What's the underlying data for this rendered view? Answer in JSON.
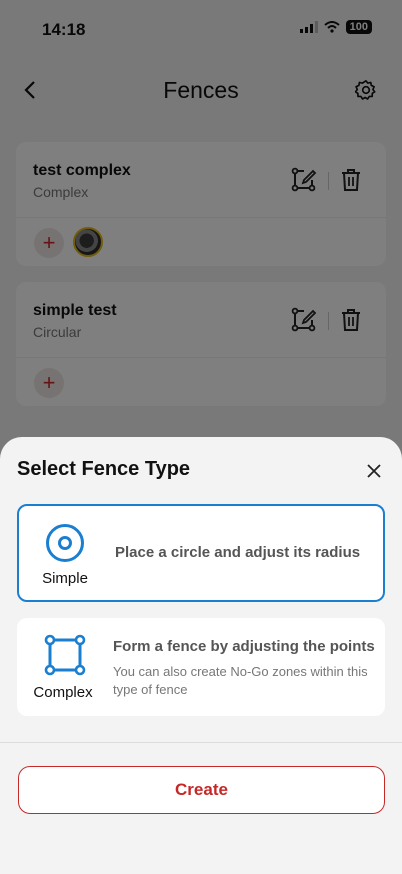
{
  "status_bar": {
    "time": "14:18",
    "battery": "100"
  },
  "nav": {
    "title": "Fences"
  },
  "fences": [
    {
      "name": "test complex",
      "type": "Complex",
      "add_label": "+"
    },
    {
      "name": "simple test",
      "type": "Circular",
      "add_label": "+"
    }
  ],
  "sheet": {
    "title": "Select Fence Type",
    "options": [
      {
        "label": "Simple",
        "description": "Place a circle and adjust its radius",
        "selected": true
      },
      {
        "label": "Complex",
        "description": "Form a fence by adjusting the points",
        "subdescription": "You can also create No-Go zones within this type of fence",
        "selected": false
      }
    ],
    "create_label": "Create"
  },
  "colors": {
    "accent": "#1a7fd1",
    "danger": "#c62828"
  }
}
